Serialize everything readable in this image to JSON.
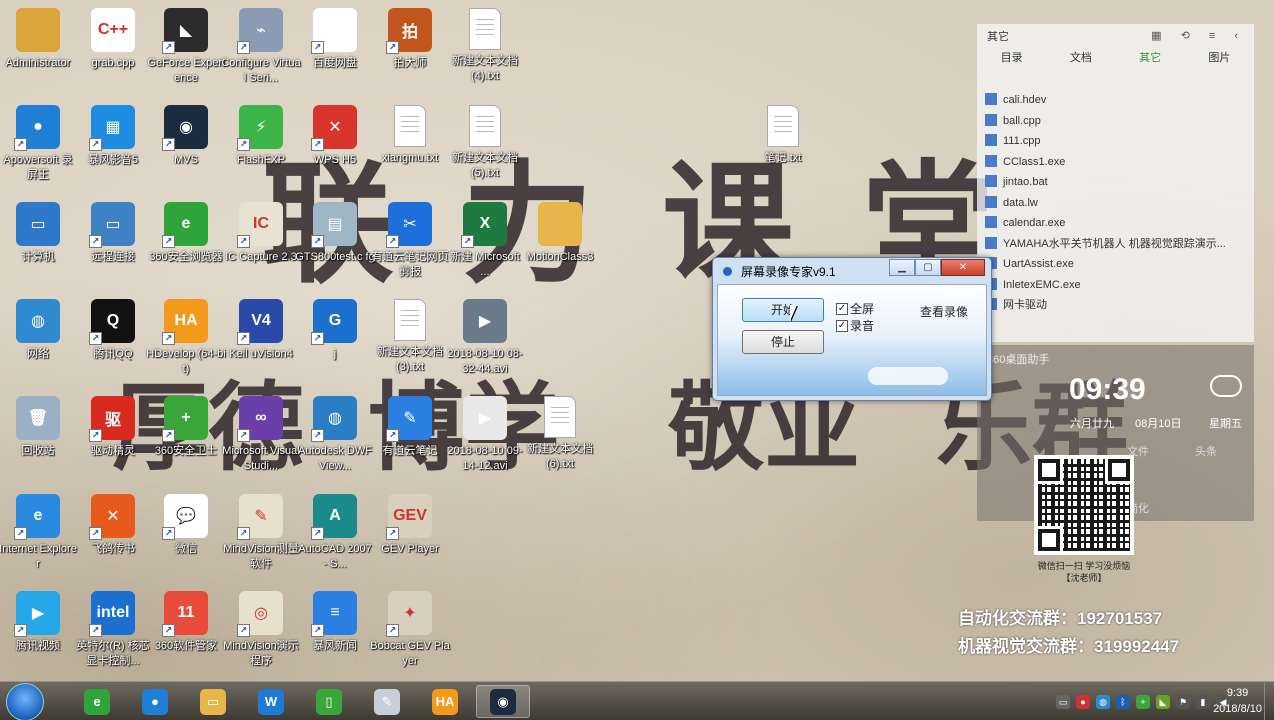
{
  "watermark": {
    "line1": [
      "联",
      "力",
      "课",
      "堂"
    ],
    "line2": [
      "厚德",
      "博学",
      "敬业",
      "乐群"
    ]
  },
  "desktop_icons": [
    {
      "label": "Administrator",
      "color": "#d9a53a",
      "glyph": "folder-user-icon",
      "text": ""
    },
    {
      "label": "grab.cpp",
      "color": "#ffffff",
      "glyph": "cpp-file-icon",
      "text": "C++"
    },
    {
      "label": "GeForce Experience",
      "color": "#2b2b2b",
      "glyph": "nvidia-icon",
      "text": "◣"
    },
    {
      "label": "Configure Virtual Seri...",
      "color": "#8a9bb3",
      "glyph": "serial-port-icon",
      "text": "⌁"
    },
    {
      "label": "百度网盘",
      "color": "#ffffff",
      "glyph": "baidu-cloud-icon",
      "text": "☁"
    },
    {
      "label": "拍大师",
      "color": "#c2561f",
      "glyph": "paidashi-icon",
      "text": "拍"
    },
    {
      "label": "新建文本文档 (4).txt",
      "color": "#ffffff",
      "glyph": "txt-file-icon",
      "text": ""
    },
    {
      "label": "Apowersoft 录屏王",
      "color": "#1f7fd6",
      "glyph": "apowersoft-icon",
      "text": "●"
    },
    {
      "label": "暴风影音5",
      "color": "#1c8de0",
      "glyph": "baofeng-icon",
      "text": "▦"
    },
    {
      "label": "MVS",
      "color": "#1a2c3d",
      "glyph": "mvs-icon",
      "text": "◉"
    },
    {
      "label": "FlashFXP",
      "color": "#3bb54a",
      "glyph": "flashfxp-icon",
      "text": "⚡"
    },
    {
      "label": "WPS H5",
      "color": "#d9342b",
      "glyph": "wps-h5-icon",
      "text": "✕"
    },
    {
      "label": "xiangmu.txt",
      "color": "#ffffff",
      "glyph": "txt-file-icon",
      "text": ""
    },
    {
      "label": "新建文本文档 (5).txt",
      "color": "#ffffff",
      "glyph": "txt-file-icon",
      "text": ""
    },
    {
      "label": "笔记.txt",
      "color": "#ffffff",
      "glyph": "txt-file-icon",
      "text": ""
    },
    {
      "label": "计算机",
      "color": "#2f78c9",
      "glyph": "computer-icon",
      "text": "▭"
    },
    {
      "label": "远程连接",
      "color": "#3d82c4",
      "glyph": "remote-desktop-icon",
      "text": "▭"
    },
    {
      "label": "360安全浏览器",
      "color": "#2ea43a",
      "glyph": "360-browser-icon",
      "text": "e"
    },
    {
      "label": "IC Capture 2.3",
      "color": "#e7e2d2",
      "glyph": "ic-capture-icon",
      "text": "IC"
    },
    {
      "label": "GTS800test.c fg",
      "color": "#9fb6c7",
      "glyph": "cfg-file-icon",
      "text": "▤"
    },
    {
      "label": "有道云笔记网页剪报",
      "color": "#1e6fdc",
      "glyph": "youdao-clip-icon",
      "text": "✂"
    },
    {
      "label": "新建 Microsoft ...",
      "color": "#1f7a42",
      "glyph": "excel-icon",
      "text": "X"
    },
    {
      "label": "MotionClass3",
      "color": "#e7b64a",
      "glyph": "folder-icon",
      "text": ""
    },
    {
      "label": "网络",
      "color": "#2f8ad0",
      "glyph": "network-icon",
      "text": "◍"
    },
    {
      "label": "腾讯QQ",
      "color": "#111111",
      "glyph": "qq-icon",
      "text": "Q"
    },
    {
      "label": "HDevelop (64-bit)",
      "color": "#f39a1c",
      "glyph": "hdevelop-icon",
      "text": "HA"
    },
    {
      "label": "Keil uVision4",
      "color": "#2a4aa8",
      "glyph": "keil-icon",
      "text": "V4"
    },
    {
      "label": "j",
      "color": "#1a6fcf",
      "glyph": "app-j-icon",
      "text": "G"
    },
    {
      "label": "新建文本文档 (3).txt",
      "color": "#ffffff",
      "glyph": "txt-file-icon",
      "text": ""
    },
    {
      "label": "2018-08-10 08-32-44.avi",
      "color": "#6a7a8a",
      "glyph": "video-file-icon",
      "text": "▶"
    },
    {
      "label": "回收站",
      "color": "#9bb0c4",
      "glyph": "recycle-bin-icon",
      "text": "🗑"
    },
    {
      "label": "驱动精灵",
      "color": "#d92a1f",
      "glyph": "driver-genius-icon",
      "text": "驱"
    },
    {
      "label": "360安全卫士",
      "color": "#3aa63a",
      "glyph": "360-safe-icon",
      "text": "+"
    },
    {
      "label": "Microsoft Visual Studi...",
      "color": "#6a3fa8",
      "glyph": "visual-studio-icon",
      "text": "∞"
    },
    {
      "label": "Autodesk DWF View...",
      "color": "#2a7fc4",
      "glyph": "autodesk-icon",
      "text": "◍"
    },
    {
      "label": "有道云笔记",
      "color": "#2a7fe0",
      "glyph": "youdao-note-icon",
      "text": "✎"
    },
    {
      "label": "2018-08-10 09-14-12.avi",
      "color": "#e8e8e8",
      "glyph": "video-file-icon",
      "text": "▶"
    },
    {
      "label": "新建文本文档 (6).txt",
      "color": "#ffffff",
      "glyph": "txt-file-icon",
      "text": ""
    },
    {
      "label": "Internet Explorer",
      "color": "#2a8ae0",
      "glyph": "ie-icon",
      "text": "e"
    },
    {
      "label": "飞鸽传书",
      "color": "#e85a1c",
      "glyph": "feige-icon",
      "text": "✕"
    },
    {
      "label": "微信",
      "color": "#ffffff",
      "glyph": "wechat-icon",
      "text": "💬"
    },
    {
      "label": "MindVision测量软件",
      "color": "#e6e0cc",
      "glyph": "mindvision-measure-icon",
      "text": "✎"
    },
    {
      "label": "AutoCAD 2007 - S...",
      "color": "#1a8a8a",
      "glyph": "autocad-icon",
      "text": "A"
    },
    {
      "label": "GEV Player",
      "color": "#d9cfbd",
      "glyph": "gev-player-icon",
      "text": "GEV"
    },
    {
      "label": "腾讯视频",
      "color": "#26a7e8",
      "glyph": "tencent-video-icon",
      "text": "▶"
    },
    {
      "label": "英特尔(R) 核芯显卡控制...",
      "color": "#1a6fcf",
      "glyph": "intel-graphics-icon",
      "text": "intel"
    },
    {
      "label": "360软件管家",
      "color": "#e84b3a",
      "glyph": "360-software-icon",
      "text": "11"
    },
    {
      "label": "MindVision演示程序",
      "color": "#e6e0cc",
      "glyph": "mindvision-demo-icon",
      "text": "◎"
    },
    {
      "label": "暴风新闻",
      "color": "#2a7fe0",
      "glyph": "baofeng-news-icon",
      "text": "≡"
    },
    {
      "label": "Bobcat GEV Player",
      "color": "#d9cfbd",
      "glyph": "bobcat-icon",
      "text": "✦"
    }
  ],
  "side_panel": {
    "title": "其它",
    "controls": "▦ ⟲ ≡ ‹",
    "tabs": [
      "目录",
      "文档",
      "其它",
      "图片"
    ],
    "active_tab": 2,
    "files": [
      "cali.hdev",
      "ball.cpp",
      "111.cpp",
      "CClass1.exe",
      "jintao.bat",
      "data.lw",
      "calendar.exe",
      "YAMAHA水平关节机器人 机器视觉跟踪演示...",
      "UartAssist.exe",
      "InletexEMC.exe",
      "网卡驱动"
    ]
  },
  "widget_360": {
    "title": "360桌面助手",
    "time": "09:39",
    "lunar": "六月廿九",
    "date": "08月10日",
    "weekday": "星期五",
    "file_label": "文件",
    "extra_label": "头条",
    "brand": "简化",
    "caption": "微信扫一扫 学习没烦恼\n【沈老师】"
  },
  "contacts": {
    "automation": "自动化交流群：192701537",
    "vision": "机器视觉交流群：319992447"
  },
  "dialog": {
    "title": "屏幕录像专家v9.1",
    "start_label": "开始",
    "stop_label": "停止",
    "fullscreen_label": "全屏",
    "audio_label": "录音",
    "view_label": "查看录像",
    "fullscreen_checked": true,
    "audio_checked": true
  },
  "taskbar": {
    "items": [
      {
        "name": "taskbar-360-browser",
        "color": "#2ea43a",
        "text": "e"
      },
      {
        "name": "taskbar-apowersoft",
        "color": "#1f7fd6",
        "text": "●"
      },
      {
        "name": "taskbar-explorer",
        "color": "#e7b64a",
        "text": "▭"
      },
      {
        "name": "taskbar-wps",
        "color": "#1e7ad6",
        "text": "W"
      },
      {
        "name": "taskbar-green-app",
        "color": "#3aa63a",
        "text": "▯"
      },
      {
        "name": "taskbar-paint",
        "color": "#c7d0da",
        "text": "✎"
      },
      {
        "name": "taskbar-hdevelop",
        "color": "#f39a1c",
        "text": "HA"
      },
      {
        "name": "taskbar-recorder",
        "color": "#1a2c3d",
        "text": "◉"
      }
    ],
    "active_index": 7,
    "time": "9:39",
    "date": "2018/8/10"
  }
}
